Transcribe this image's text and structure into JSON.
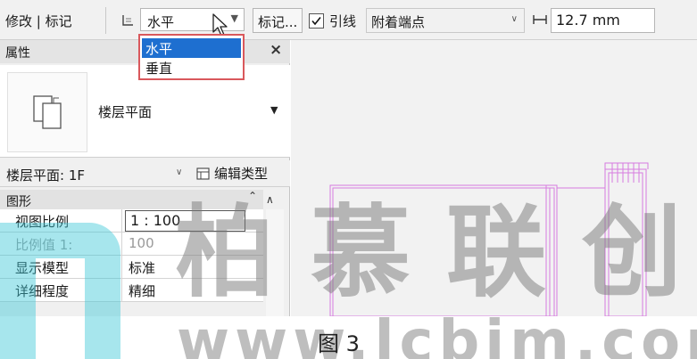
{
  "options_bar": {
    "context_label": "修改 | 标记",
    "orientation_value": "水平",
    "tag_button_label": "标记...",
    "leader_checked": true,
    "leader_label": "引线",
    "attach_value": "附着端点",
    "leader_length_value": "12.7 mm"
  },
  "orientation_dropdown": {
    "options": [
      "水平",
      "垂直"
    ],
    "selected_index": 0
  },
  "properties": {
    "title": "属性",
    "close_symbol": "×",
    "type_name": "楼层平面",
    "instance_filter": "楼层平面: 1F",
    "edit_type_label": "编辑类型",
    "group_title": "图形",
    "rows": [
      {
        "name": "视图比例",
        "value": "1 : 100",
        "editable": true,
        "dim": false
      },
      {
        "name": "比例值 1:",
        "value": "100",
        "editable": false,
        "dim": true
      },
      {
        "name": "显示模型",
        "value": "标准",
        "editable": false,
        "dim": false
      },
      {
        "name": "详细程度",
        "value": "精细",
        "editable": false,
        "dim": false
      }
    ]
  },
  "caption": "图 3",
  "watermark": {
    "text": "柏慕联创",
    "url": "www.lcbim.com"
  },
  "colors": {
    "selection_blue": "#1e6fd0",
    "dropdown_border": "#d9585c",
    "drawing_line": "#d77be0"
  }
}
